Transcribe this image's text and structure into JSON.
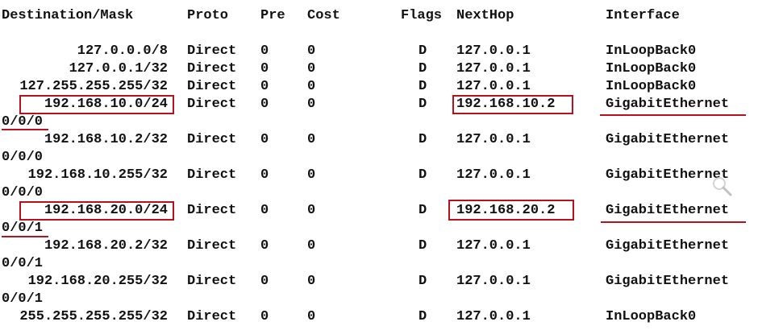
{
  "columns": [
    "Destination/Mask",
    "Proto",
    "Pre",
    "Cost",
    "Flags",
    "NextHop",
    "Interface"
  ],
  "routes": [
    {
      "destination": "127.0.0.0/8",
      "proto": "Direct",
      "pre": "0",
      "cost": "0",
      "flags": "D",
      "nexthop": "127.0.0.1",
      "interface": "InLoopBack0",
      "interface_cont": ""
    },
    {
      "destination": "127.0.0.1/32",
      "proto": "Direct",
      "pre": "0",
      "cost": "0",
      "flags": "D",
      "nexthop": "127.0.0.1",
      "interface": "InLoopBack0",
      "interface_cont": ""
    },
    {
      "destination": "127.255.255.255/32",
      "proto": "Direct",
      "pre": "0",
      "cost": "0",
      "flags": "D",
      "nexthop": "127.0.0.1",
      "interface": "InLoopBack0",
      "interface_cont": ""
    },
    {
      "destination": "192.168.10.0/24",
      "proto": "Direct",
      "pre": "0",
      "cost": "0",
      "flags": "D",
      "nexthop": "192.168.10.2",
      "interface": "GigabitEthernet",
      "interface_cont": "0/0/0"
    },
    {
      "destination": "192.168.10.2/32",
      "proto": "Direct",
      "pre": "0",
      "cost": "0",
      "flags": "D",
      "nexthop": "127.0.0.1",
      "interface": "GigabitEthernet",
      "interface_cont": "0/0/0"
    },
    {
      "destination": "192.168.10.255/32",
      "proto": "Direct",
      "pre": "0",
      "cost": "0",
      "flags": "D",
      "nexthop": "127.0.0.1",
      "interface": "GigabitEthernet",
      "interface_cont": "0/0/0"
    },
    {
      "destination": "192.168.20.0/24",
      "proto": "Direct",
      "pre": "0",
      "cost": "0",
      "flags": "D",
      "nexthop": "192.168.20.2",
      "interface": "GigabitEthernet",
      "interface_cont": "0/0/1"
    },
    {
      "destination": "192.168.20.2/32",
      "proto": "Direct",
      "pre": "0",
      "cost": "0",
      "flags": "D",
      "nexthop": "127.0.0.1",
      "interface": "GigabitEthernet",
      "interface_cont": "0/0/1"
    },
    {
      "destination": "192.168.20.255/32",
      "proto": "Direct",
      "pre": "0",
      "cost": "0",
      "flags": "D",
      "nexthop": "127.0.0.1",
      "interface": "GigabitEthernet",
      "interface_cont": "0/0/1"
    },
    {
      "destination": "255.255.255.255/32",
      "proto": "Direct",
      "pre": "0",
      "cost": "0",
      "flags": "D",
      "nexthop": "127.0.0.1",
      "interface": "InLoopBack0",
      "interface_cont": ""
    }
  ],
  "highlight_color": "#b5121b",
  "icons": {
    "magnifier": "magnifier-icon"
  }
}
